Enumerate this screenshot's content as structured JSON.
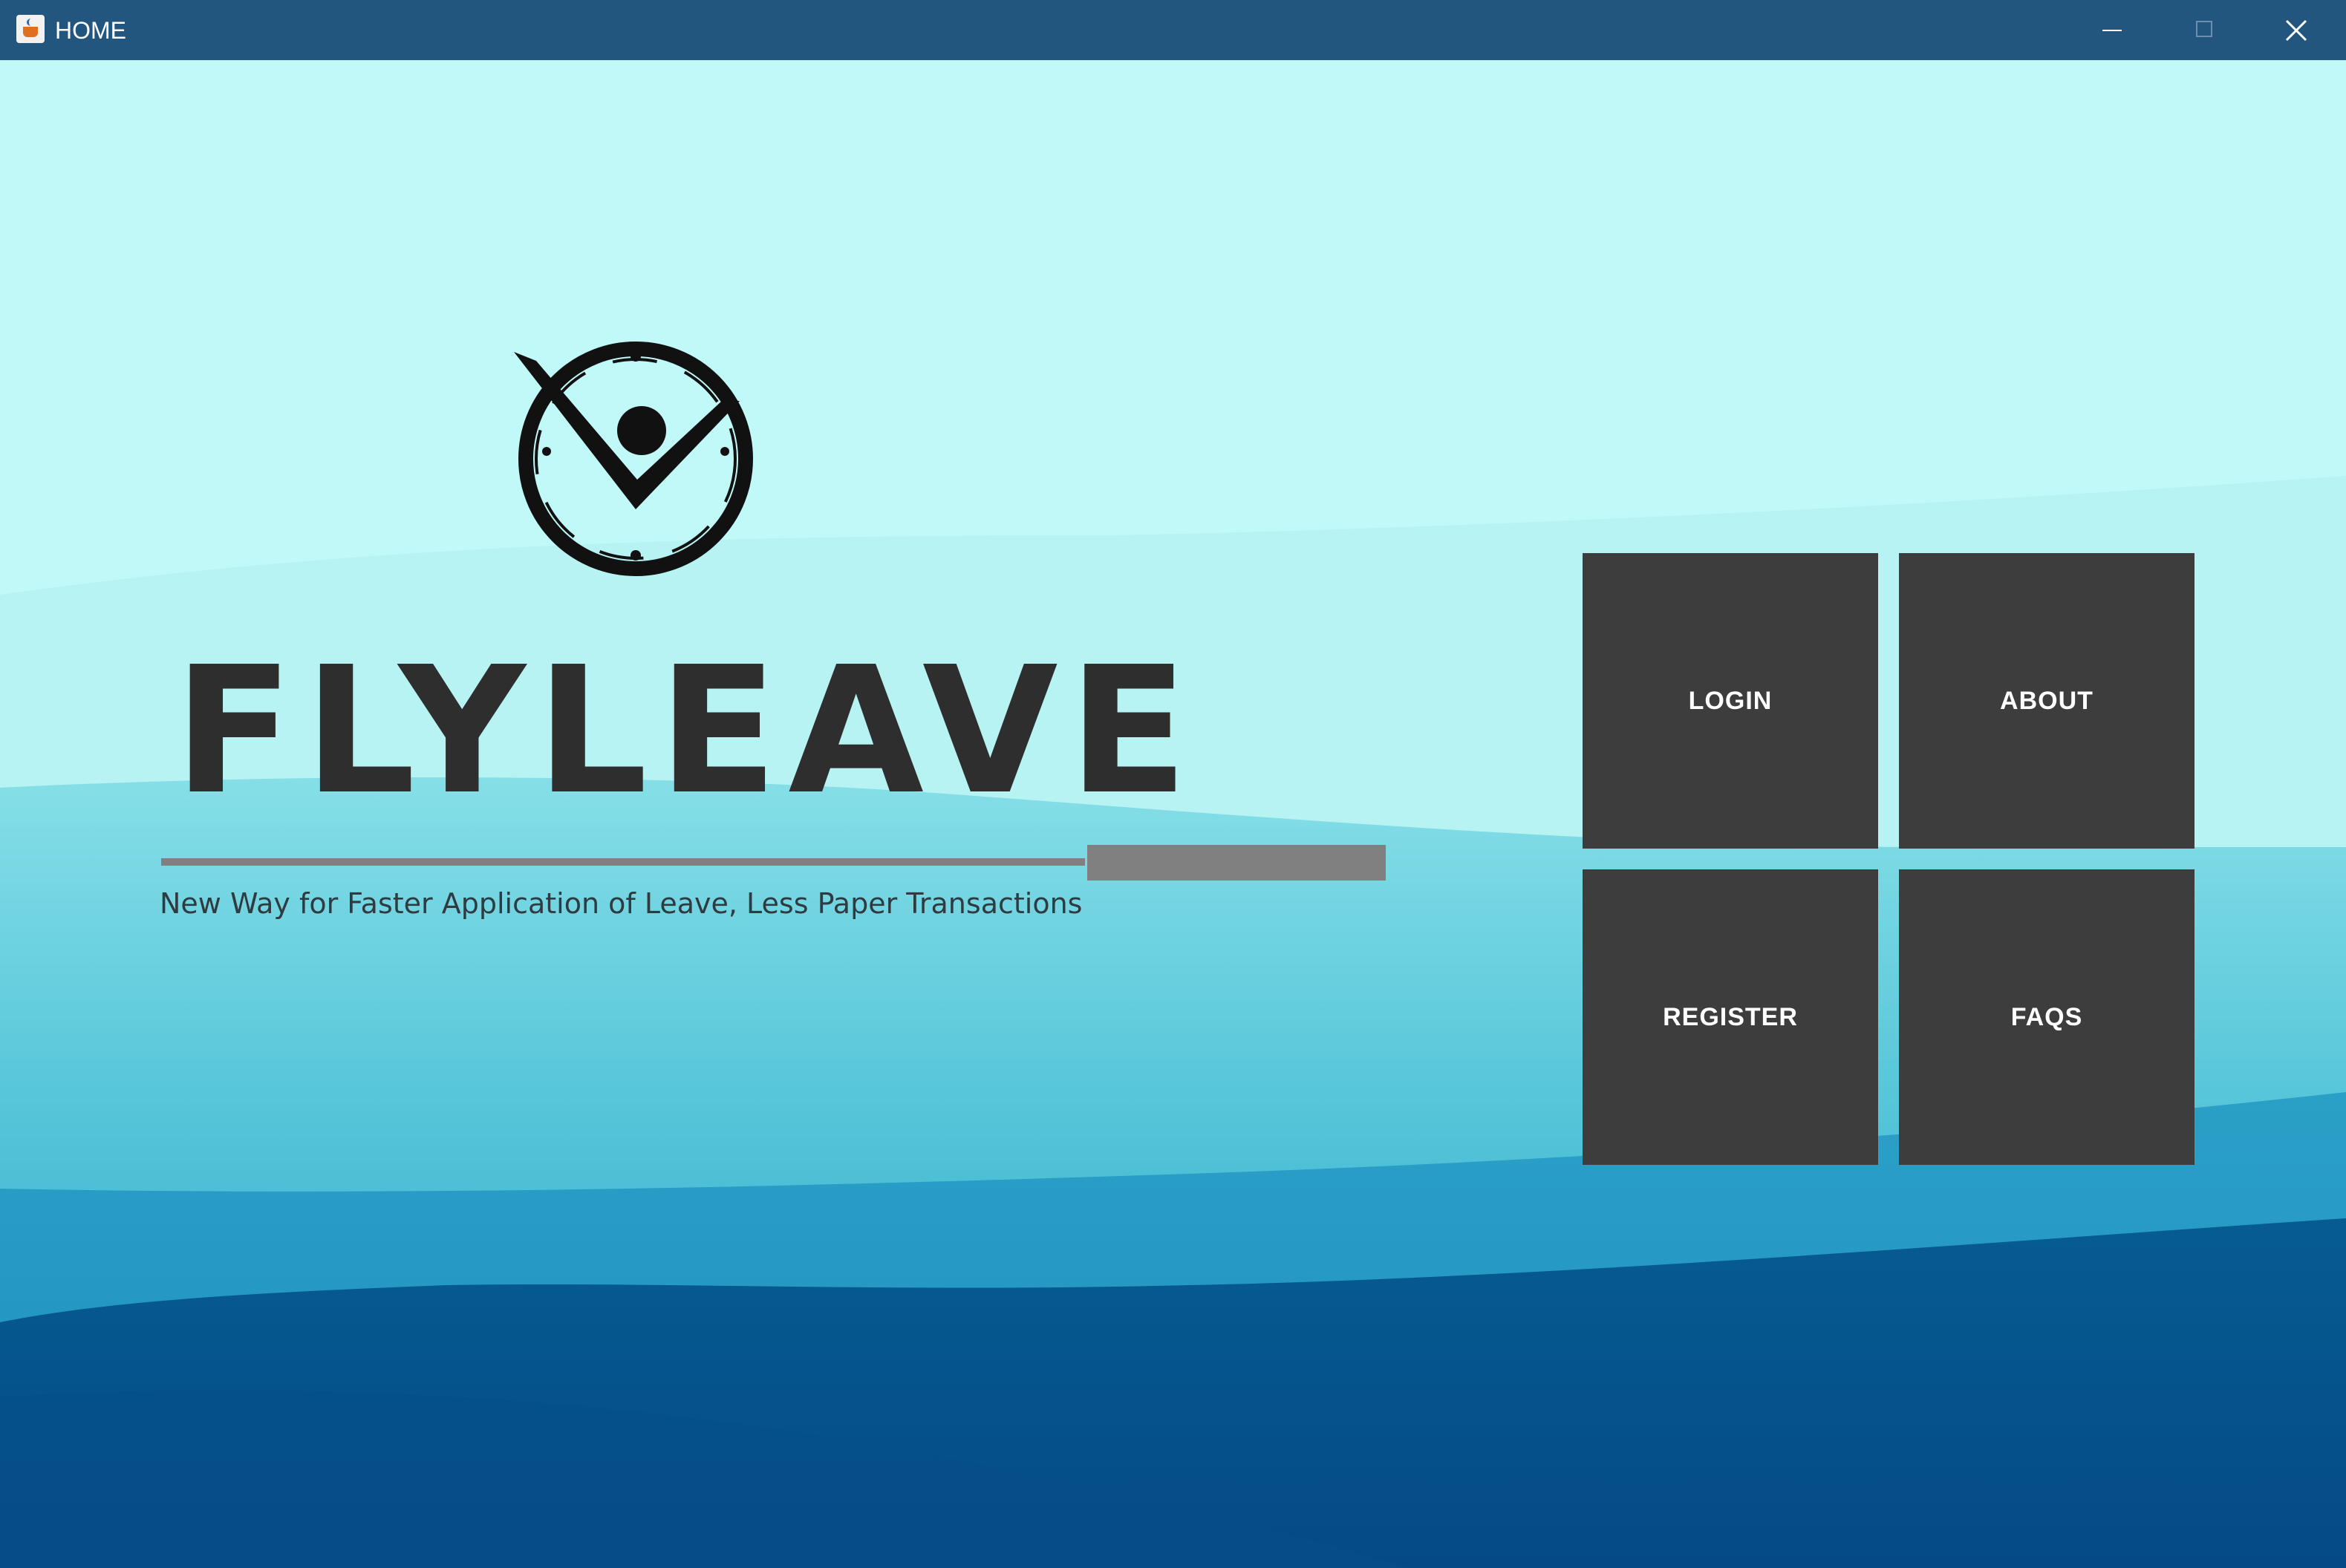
{
  "window": {
    "title": "HOME",
    "icon": "java-cup-icon",
    "controls": [
      "minimize-icon",
      "maximize-icon",
      "close-icon"
    ]
  },
  "brand": {
    "logo": "flyleave-clock-check-logo",
    "name": "FLYLEAVE",
    "tagline": "New Way for Faster Application of Leave, Less Paper Transactions"
  },
  "menu": {
    "login": "LOGIN",
    "about": "ABOUT",
    "register": "REGISTER",
    "faqs": "FAQS"
  },
  "colors": {
    "titlebar": "#23567f",
    "sky": "#c0f9f8",
    "tile": "#3d3d3d",
    "tile_text": "#ffffff",
    "brand_text": "#2e2e2e",
    "divider": "#808080",
    "wave_light": "#7fd7e2",
    "wave_mid": "#2f9fc6",
    "wave_deep": "#05598f"
  }
}
